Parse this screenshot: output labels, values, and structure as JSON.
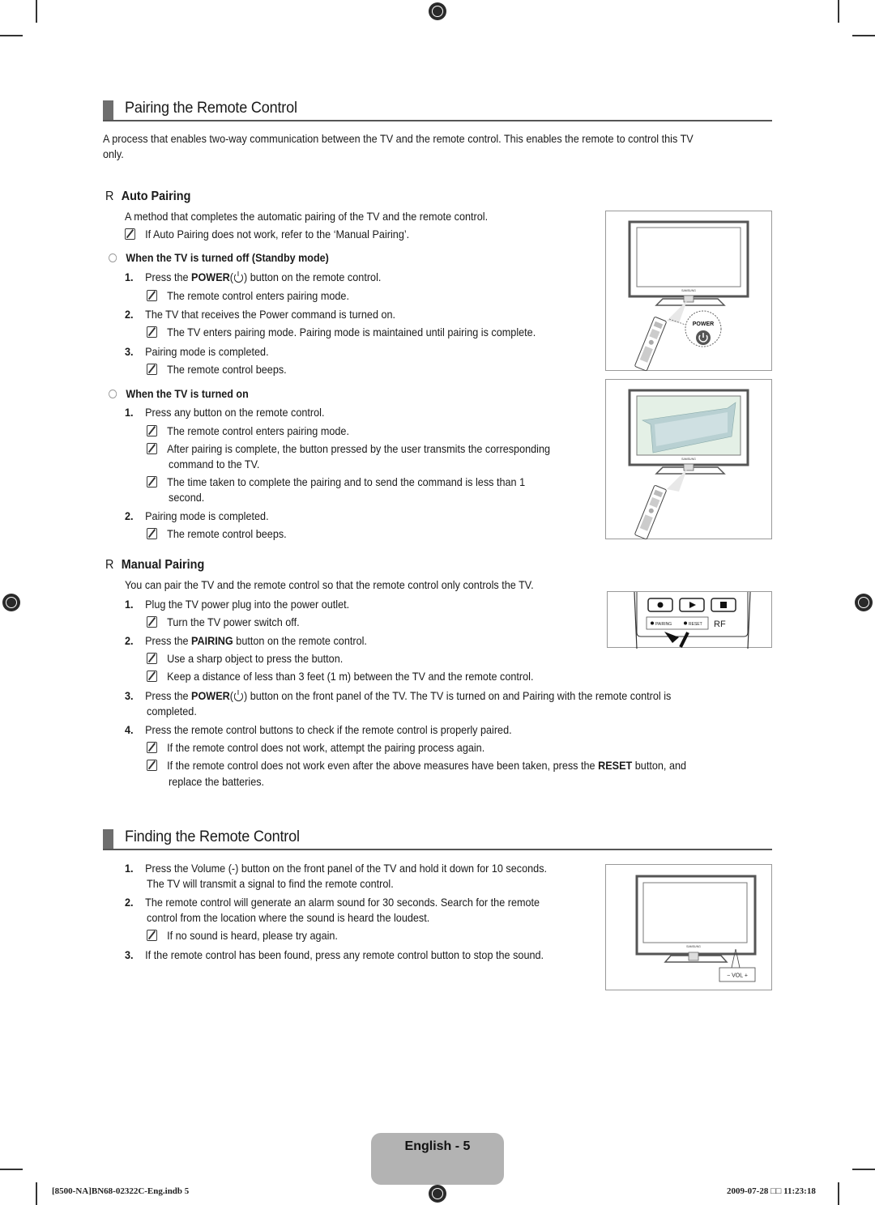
{
  "section1": {
    "title": "Pairing the Remote Control",
    "intro_line1": "A process that enables two-way communication between the TV and the remote control. This enables the remote to control this TV",
    "intro_line2": "only."
  },
  "auto_pairing": {
    "marker": "R",
    "title": "Auto Pairing",
    "desc": "A method that completes the automatic pairing of the TV and the remote control.",
    "note": "If Auto Pairing does not work, refer to the ‘Manual Pairing’.",
    "standby": {
      "title": "When the TV is turned off (Standby mode)",
      "s1_num": "1.",
      "s1_pre": "Press the ",
      "s1_bold": "POWER",
      "s1_post": ") button on the remote control.",
      "s1_note": "The remote control enters pairing mode.",
      "s2_num": "2.",
      "s2": "The TV that receives the Power command is turned on.",
      "s2_note": "The TV enters pairing mode. Pairing mode is maintained until pairing is complete.",
      "s3_num": "3.",
      "s3": "Pairing mode is completed.",
      "s3_note": "The remote control beeps."
    },
    "turned_on": {
      "title": "When the TV is turned on",
      "s1_num": "1.",
      "s1": "Press any button on the remote control.",
      "s1_note1": "The remote control enters pairing mode.",
      "s1_note2_l1": "After pairing is complete, the button pressed by the user transmits the corresponding",
      "s1_note2_l2": "command to the TV.",
      "s1_note3_l1": "The time taken to complete the pairing and to send the command is less than 1",
      "s1_note3_l2": "second.",
      "s2_num": "2.",
      "s2": "Pairing mode is completed.",
      "s2_note": "The remote control beeps."
    }
  },
  "manual_pairing": {
    "marker": "R",
    "title": "Manual Pairing",
    "desc": "You can pair the TV and the remote control so that the remote control only controls the TV.",
    "s1_num": "1.",
    "s1": "Plug the TV power plug into the power outlet.",
    "s1_note": "Turn the TV power switch off.",
    "s2_num": "2.",
    "s2_pre": "Press the ",
    "s2_bold": "PAIRING",
    "s2_post": " button on the remote control.",
    "s2_note1": "Use a sharp object to press the button.",
    "s2_note2": "Keep a distance of less than 3 feet (1 m) between the TV and the remote control.",
    "s3_num": "3.",
    "s3_pre": "Press the ",
    "s3_bold": "POWER",
    "s3_post": ") button on the front panel of the TV. The TV is turned on and Pairing with the remote control is",
    "s3_l2": "completed.",
    "s4_num": "4.",
    "s4": "Press the remote control buttons to check if the remote control is properly paired.",
    "s4_note1": "If the remote control does not work, attempt the pairing process again.",
    "s4_note2_pre": "If the remote control does not work even after the above measures have been taken, press the ",
    "s4_note2_bold": "RESET",
    "s4_note2_post": " button, and",
    "s4_note2_l2": "replace the batteries."
  },
  "section2": {
    "title": "Finding the Remote Control",
    "s1_num": "1.",
    "s1_l1": "Press the Volume (-) button on the front panel of the TV and hold it down for 10 seconds.",
    "s1_l2": "The TV will transmit a signal to find the remote control.",
    "s2_num": "2.",
    "s2_l1": "The remote control will generate an alarm sound for 30 seconds. Search for the remote",
    "s2_l2": "control from the location where the sound is heard the loudest.",
    "s2_note": "If no sound is heard, please try again.",
    "s3_num": "3.",
    "s3": "If the remote control has been found, press any remote control button to stop the sound."
  },
  "figures": {
    "fig1_power_label": "POWER",
    "brand": "SAMSUNG",
    "fig3_pairing": "PAIRING",
    "fig3_reset": "RESET",
    "fig3_rf": "RF",
    "fig4_vol": "− VOL +"
  },
  "footer": {
    "page_label": "English - 5",
    "file": "[8500-NA]BN68-02322C-Eng.indb   5",
    "timestamp": "2009-07-28   □□ 11:23:18"
  }
}
